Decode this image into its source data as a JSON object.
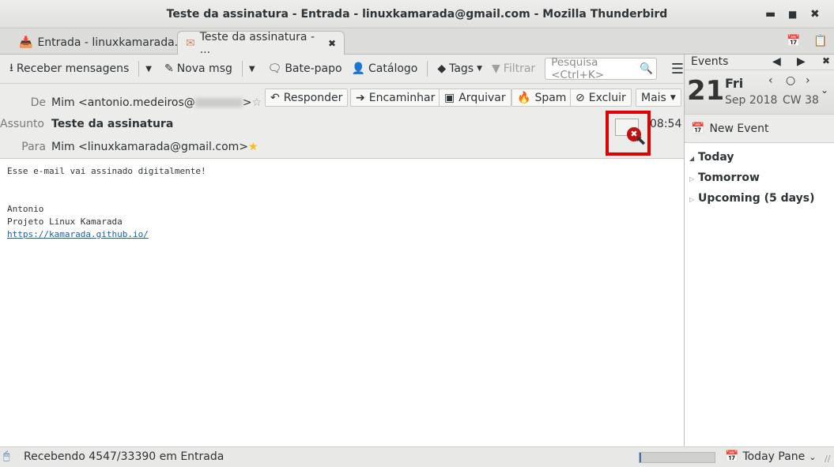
{
  "window": {
    "title": "Teste da assinatura - Entrada - linuxkamarada@gmail.com - Mozilla Thunderbird"
  },
  "tabs": [
    {
      "label": "Entrada - linuxkamarada..."
    },
    {
      "label": "Teste da assinatura - ..."
    }
  ],
  "toolbar": {
    "get_messages": "Receber mensagens",
    "write": "Nova msg",
    "chat": "Bate-papo",
    "address_book": "Catálogo",
    "tags": "Tags",
    "filter": "Filtrar",
    "search_placeholder": "Pesquisa <Ctrl+K>"
  },
  "message": {
    "from_label": "De",
    "from": "Mim <antonio.medeiros@",
    "from_end": ">",
    "subject_label": "Assunto",
    "subject": "Teste da assinatura",
    "to_label": "Para",
    "to": "Mim <linuxkamarada@gmail.com>",
    "time": "08:54",
    "actions": {
      "reply": "Responder",
      "forward": "Encaminhar",
      "archive": "Arquivar",
      "junk": "Spam",
      "delete": "Excluir",
      "more": "Mais"
    },
    "body": [
      "Esse e-mail vai assinado digitalmente!",
      "",
      "",
      "Antonio",
      "Projeto Linux Kamarada"
    ],
    "link": "https://kamarada.github.io/"
  },
  "today_pane": {
    "title": "Events",
    "day": "21",
    "weekday": "Fri",
    "month_year": "Sep 2018",
    "week": "CW 38",
    "new_event": "New Event",
    "sections": [
      "Today",
      "Tomorrow",
      "Upcoming (5 days)"
    ]
  },
  "status": {
    "text": "Recebendo 4547/33390 em Entrada",
    "progress": 0.02,
    "today_pane": "Today Pane"
  },
  "colors": {
    "highlight": "#e00000",
    "link": "#1a5fb4"
  }
}
